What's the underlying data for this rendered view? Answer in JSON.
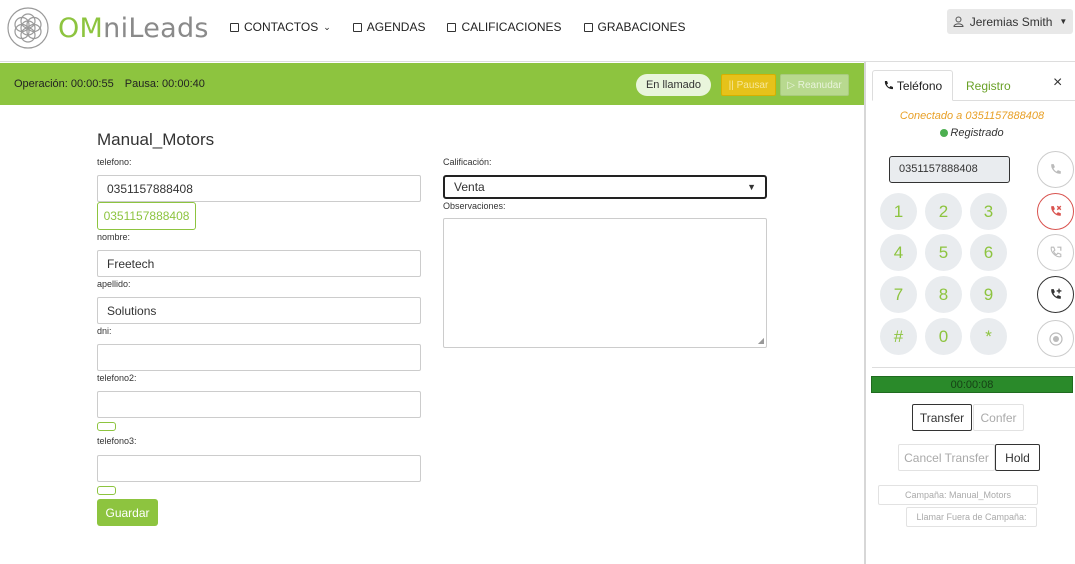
{
  "brand": {
    "logo_main": "OM",
    "logo_rest": "niLeads",
    "logo_color": "#8dc43f"
  },
  "nav": [
    {
      "label": "CONTACTOS",
      "has_dropdown": true,
      "icon": "address-book-icon"
    },
    {
      "label": "AGENDAS",
      "icon": "calendar-icon"
    },
    {
      "label": "CALIFICACIONES",
      "icon": "check-square-icon"
    },
    {
      "label": "GRABACIONES",
      "icon": "recording-icon"
    }
  ],
  "user": {
    "name": "Jeremias Smith",
    "icon": "user-icon"
  },
  "status": {
    "operacion": "Operación: 00:00:55",
    "pausa": "Pausa: 00:00:40",
    "state_pill": "En llamado",
    "pause_button": "|| Pausar",
    "resume_button": "▷ Reanudar",
    "bar_color": "#8dc43f"
  },
  "form": {
    "title": "Manual_Motors",
    "telefono_label": "telefono:",
    "telefono_value": "0351157888408",
    "telefono_chip": "0351157888408",
    "nombre_label": "nombre:",
    "nombre_value": "Freetech",
    "apellido_label": "apellido:",
    "apellido_value": "Solutions",
    "dni_label": "dni:",
    "dni_value": "",
    "telefono2_label": "telefono2:",
    "telefono2_value": "",
    "telefono3_label": "telefono3:",
    "telefono3_value": "",
    "save_button": "Guardar",
    "calificacion_label": "Calificación:",
    "calificacion_value": "Venta",
    "observaciones_label": "Observaciones:"
  },
  "phone": {
    "tab_phone": "Teléfono",
    "tab_log": "Registro",
    "close": "×",
    "connected": "Conectado a 0351157888408",
    "registered": "Registrado",
    "dial_value": "0351157888408",
    "keys": [
      "1",
      "2",
      "3",
      "4",
      "5",
      "6",
      "7",
      "8",
      "9",
      "#",
      "0",
      "*"
    ],
    "timer": "00:00:08",
    "transfer": "Transfer",
    "confer": "Confer",
    "cancel_transfer": "Cancel Transfer",
    "hold": "Hold",
    "campaign": "Campaña: Manual_Motors",
    "call_outside": "Llamar Fuera de Campaña:"
  }
}
